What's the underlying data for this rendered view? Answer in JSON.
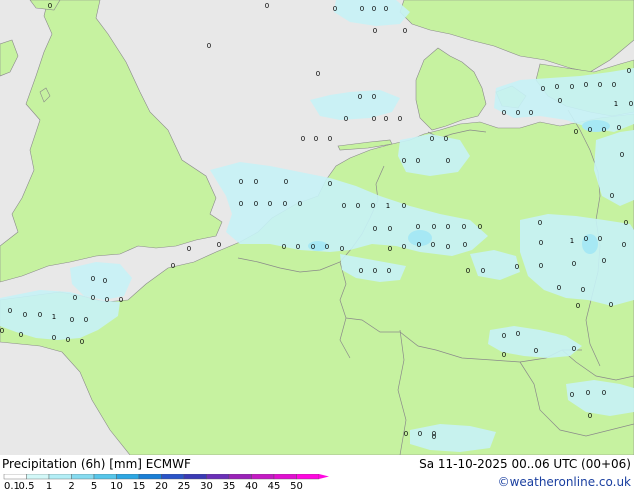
{
  "title": "Precipitation (6h) [mm] ECMWF",
  "datetime": "Sa 11-10-2025 00..06 UTC (00+06)",
  "credit": "©weatheronline.co.uk",
  "colors": {
    "sea": "#e8e8e8",
    "land": "#c6f2a0",
    "border": "#8a8a8a",
    "precip_light": "#c6f2f6",
    "precip_mid": "#a6e8f4"
  },
  "legend": {
    "ticks": [
      "0.1",
      "0.5",
      "1",
      "2",
      "5",
      "10",
      "15",
      "20",
      "25",
      "30",
      "35",
      "40",
      "45",
      "50"
    ],
    "colors": [
      "#ffffff",
      "#d3f8f8",
      "#b3eef6",
      "#86dbf0",
      "#57c6ea",
      "#2da7e3",
      "#1a7fd6",
      "#2a54c8",
      "#3a3ab5",
      "#6a2fb8",
      "#9a22b8",
      "#c41ac4",
      "#e010d0",
      "#ff08e0"
    ]
  },
  "map_labels": [
    "0",
    "1"
  ]
}
